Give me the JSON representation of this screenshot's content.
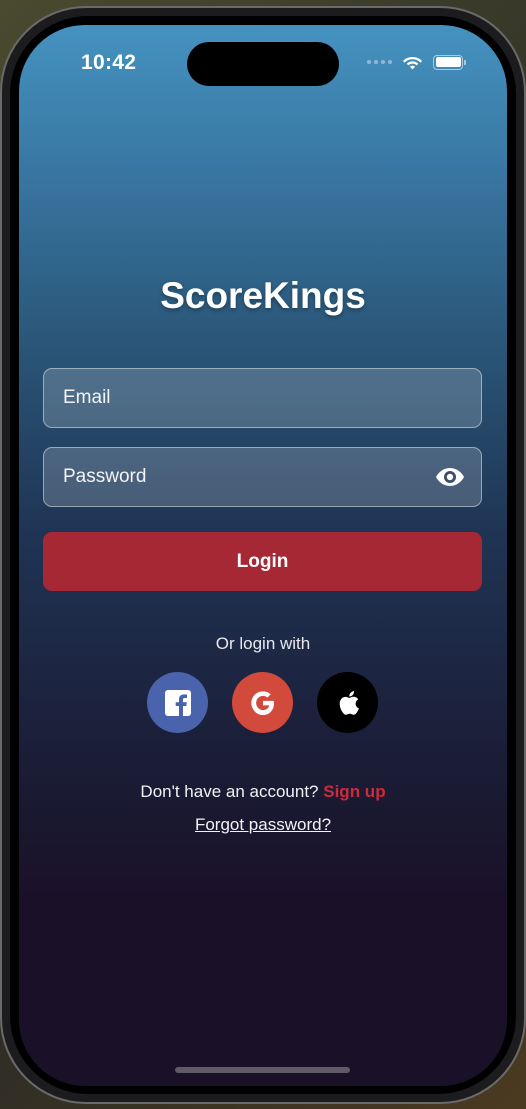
{
  "status_bar": {
    "time": "10:42"
  },
  "app": {
    "title": "ScoreKings"
  },
  "form": {
    "email_placeholder": "Email",
    "password_placeholder": "Password",
    "login_label": "Login"
  },
  "social": {
    "prompt": "Or login with",
    "buttons": [
      {
        "icon": "facebook-icon",
        "color": "#4a63ad"
      },
      {
        "icon": "google-icon",
        "color": "#d24a3c"
      },
      {
        "icon": "apple-icon",
        "color": "#000000"
      }
    ]
  },
  "footer": {
    "signup_prompt": "Don't have an account?",
    "signup_link": "Sign up",
    "forgot_password": "Forgot password?"
  },
  "colors": {
    "accent": "#a72835",
    "link": "#cc2b3b",
    "gradient_top": "#4592c0",
    "gradient_bottom": "#1a1027"
  }
}
